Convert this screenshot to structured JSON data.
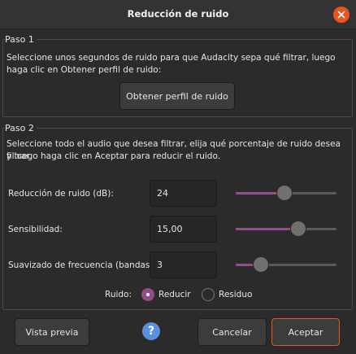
{
  "dialog": {
    "title": "Reducción de ruido"
  },
  "step1": {
    "title": "Paso 1",
    "description_line1": "Seleccione unos segundos de ruido para que Audacity sepa qué filtrar, luego",
    "description_line2": "haga clic en Obtener perfil de ruido:",
    "profile_button": "Obtener perfil de ruido"
  },
  "step2": {
    "title": "Paso 2",
    "description_line1": "Seleccione todo el audio que desea filtrar, elija qué porcentaje de ruido desea filtrar",
    "description_line2": "y luego haga clic en Aceptar para reducir el ruido.",
    "fields": [
      {
        "label": "Reducción de ruido (dB):",
        "value": "24",
        "slider_fraction": 0.48
      },
      {
        "label": "Sensibilidad:",
        "value": "15,00",
        "slider_fraction": 0.62
      },
      {
        "label": "Suavizado de frecuencia (bandas):",
        "value": "3",
        "slider_fraction": 0.25
      }
    ],
    "noise_label": "Ruido:",
    "options": [
      {
        "label": "Reducir",
        "selected": true
      },
      {
        "label": "Residuo",
        "selected": false
      }
    ]
  },
  "footer": {
    "preview_button": "Vista previa",
    "help_glyph": "?",
    "cancel_button": "Cancelar",
    "accept_button": "Aceptar"
  },
  "colors": {
    "accent": "#924d8b",
    "close": "#e95420",
    "help": "#5b8fe0"
  },
  "icons": {
    "close": "close-icon",
    "help": "help-icon"
  }
}
